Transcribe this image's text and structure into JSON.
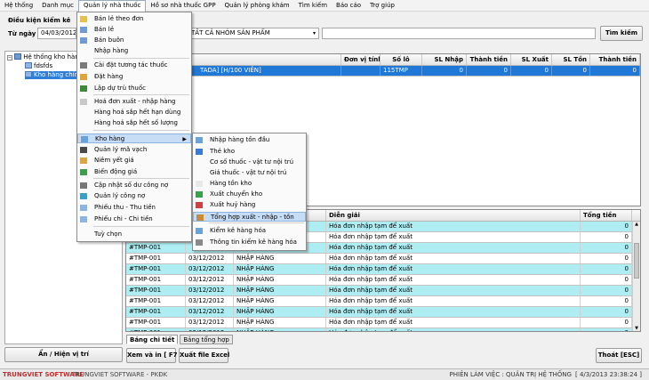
{
  "menubar": [
    "Hệ thống",
    "Danh mục",
    "Quản lý nhà thuốc",
    "Hồ sơ nhà thuốc GPP",
    "Quản lý phòng khám",
    "Tìm kiếm",
    "Báo cáo",
    "Trợ giúp"
  ],
  "left": {
    "title": "Điều kiện kiểm kê",
    "from_label": "Từ ngày :",
    "from_value": "04/03/2012",
    "tree": [
      "Hệ thống kho hàn",
      "fdsfds",
      "Kho hàng chín"
    ],
    "toggle_btn": "Ẩn / Hiện vị trí"
  },
  "filter": {
    "group_value": "TẤT CẢ NHÓM SẢN PHẨM",
    "search_value": "",
    "search_btn": "Tìm kiếm"
  },
  "top_grid": {
    "headers": [
      "Đơn vị tính",
      "Số lô",
      "SL Nhập",
      "Thành tiền",
      "SL Xuất",
      "SL Tồn",
      "Thành tiền"
    ],
    "row": {
      "name": "TADA] [H/100 VIÊN]",
      "lot": "115TMP",
      "sl_nhap": "0",
      "tt1": "0",
      "sl_xuat": "0",
      "sl_ton": "0",
      "tt2": "0"
    }
  },
  "bottom_grid": {
    "headers": [
      "Diễn giải",
      "Tổng tiền"
    ],
    "rows": [
      {
        "code": "",
        "date": "",
        "type": "",
        "desc": "Hóa đơn nhập tạm để xuất",
        "total": "0"
      },
      {
        "code": "",
        "date": "",
        "type": "",
        "desc": "Hóa đơn nhập tạm để xuất",
        "total": "0"
      },
      {
        "code": "#TMP-001",
        "date": "",
        "type": "",
        "desc": "Hóa đơn nhập tạm để xuất",
        "total": "0"
      },
      {
        "code": "#TMP-001",
        "date": "03/12/2012",
        "type": "NHẬP HÀNG",
        "desc": "Hóa đơn nhập tạm để xuất",
        "total": "0"
      },
      {
        "code": "#TMP-001",
        "date": "03/12/2012",
        "type": "NHẬP HÀNG",
        "desc": "Hóa đơn nhập tạm để xuất",
        "total": "0"
      },
      {
        "code": "#TMP-001",
        "date": "03/12/2012",
        "type": "NHẬP HÀNG",
        "desc": "Hóa đơn nhập tạm để xuất",
        "total": "0"
      },
      {
        "code": "#TMP-001",
        "date": "03/12/2012",
        "type": "NHẬP HÀNG",
        "desc": "Hóa đơn nhập tạm để xuất",
        "total": "0"
      },
      {
        "code": "#TMP-001",
        "date": "03/12/2012",
        "type": "NHẬP HÀNG",
        "desc": "Hóa đơn nhập tạm để xuất",
        "total": "0"
      },
      {
        "code": "#TMP-001",
        "date": "03/12/2012",
        "type": "NHẬP HÀNG",
        "desc": "Hóa đơn nhập tạm để xuất",
        "total": "0"
      },
      {
        "code": "#TMP-001",
        "date": "03/12/2012",
        "type": "NHẬP HÀNG",
        "desc": "Hóa đơn nhập tạm để xuất",
        "total": "0"
      },
      {
        "code": "#TMP-001",
        "date": "03/12/2012",
        "type": "NHẬP HÀNG",
        "desc": "Hóa đơn nhập tạm để xuất",
        "total": "0"
      }
    ]
  },
  "tabs": [
    "Bảng chi tiết",
    "Bảng tổng hợp"
  ],
  "buttons": {
    "print": "Xem và in [ F7 ]",
    "excel": "Xuất file Excel",
    "exit": "Thoát  [ESC]"
  },
  "main_menu": [
    "Bán lẻ theo đơn",
    "Bán lẻ",
    "Bán buôn",
    "Nhập hàng",
    "Cài đặt tương tác thuốc",
    "Đặt hàng",
    "Lập dự trù thuốc",
    "Hoá đơn xuất - nhập hàng",
    "Hàng hoá sắp hết hạn dùng",
    "Hàng hoá sắp hết số lượng",
    "Kho hàng",
    "Quản lý mã vạch",
    "Niêm yết giá",
    "Biến động giá",
    "Cập nhật số dư công nợ",
    "Quản lý công nợ",
    "Phiếu thu - Thu tiền",
    "Phiếu chi - Chi tiền",
    "Tuỳ chọn"
  ],
  "sub_menu": [
    "Nhập hàng tồn đầu",
    "Thẻ kho",
    "Cơ số thuốc - vật tư nội trú",
    "Giá thuốc - vật tư nội trú",
    "Hàng tồn kho",
    "Xuất chuyển kho",
    "Xuất huỷ hàng",
    "Tổng hợp xuất - nhập - tồn",
    "Kiểm kê hàng hóa",
    "Thông tin kiểm kê hàng hóa"
  ],
  "status": {
    "brand": "TRUNGVIET SOFTWARE",
    "company": "TRUNGVIET SOFTWARE - PKĐK",
    "session": "PHIÊN LÀM VIỆC : QUẢN TRỊ HỆ THỐNG",
    "time": "[ 4/3/2013 23:38:24 ]"
  }
}
